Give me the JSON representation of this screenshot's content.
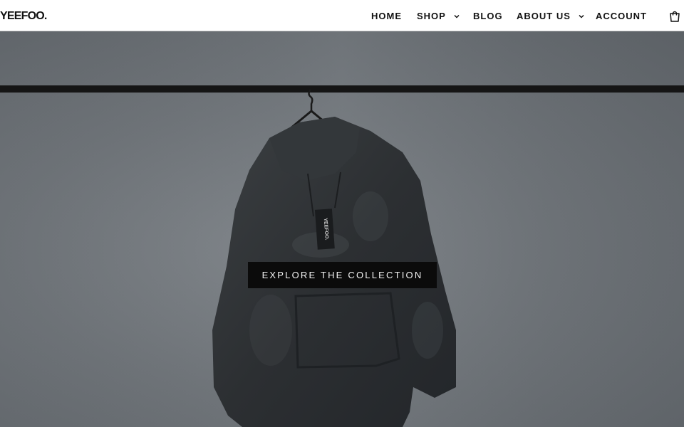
{
  "brand": {
    "logo_text": "YEEFOO."
  },
  "nav": {
    "home": "HOME",
    "shop": "SHOP",
    "blog": "BLOG",
    "about": "ABOUT US",
    "account": "ACCOUNT"
  },
  "icons": {
    "shop_dropdown": "chevron-down-icon",
    "about_dropdown": "chevron-down-icon",
    "cart": "shopping-bag-icon"
  },
  "hero": {
    "cta_label": "EXPLORE THE COLLECTION",
    "hang_tag_text": "YEEFOO.",
    "image_subject": "dark acid-wash hoodie hanging on a rail"
  },
  "colors": {
    "header_bg": "#ffffff",
    "text": "#111111",
    "cta_bg": "#0b0b0b",
    "cta_text": "#f3f3f3"
  }
}
